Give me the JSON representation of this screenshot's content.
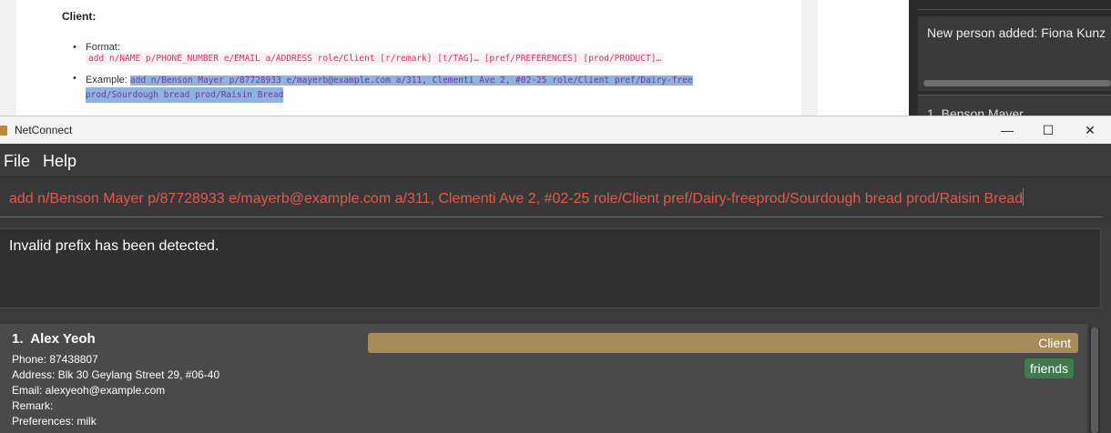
{
  "doc": {
    "heading": "Client:",
    "format_label": "Format:",
    "format_code": "add n/NAME p/PHONE_NUMBER e/EMAIL a/ADDRESS role/Client [r/remark] [t/TAG]… [pref/PREFERENCES] [prod/PRODUCT]…",
    "example_label": "Example:",
    "example_code_line1": "add n/Benson Mayer p/87728933 e/mayerb@example.com a/311, Clementi Ave 2, #02-25 role/Client pref/Dairy-free",
    "example_code_line2": "prod/Sourdough bread prod/Raisin Bread"
  },
  "other_app": {
    "message": "New person added: Fiona Kunz",
    "list_item": "1.  Benson Mayer"
  },
  "window": {
    "title": "NetConnect",
    "minimize_icon": "—",
    "maximize_icon": "☐",
    "close_icon": "✕"
  },
  "menu": {
    "file": "File",
    "help": "Help"
  },
  "command": {
    "value": "add n/Benson Mayer p/87728933 e/mayerb@example.com a/311, Clementi Ave 2, #02-25 role/Client pref/Dairy-freeprod/Sourdough bread prod/Raisin Bread"
  },
  "result": {
    "message": "Invalid prefix has been detected."
  },
  "persons": [
    {
      "index": "1.",
      "name": "Alex Yeoh",
      "phone": "Phone: 87438807",
      "address": "Address: Blk 30 Geylang Street 29, #06-40",
      "email": "Email: alexyeoh@example.com",
      "remark": "Remark:",
      "preferences": "Preferences: milk",
      "role_tag": "Client",
      "tag": "friends"
    }
  ],
  "colors": {
    "role_tag": "#a68b5b",
    "friends_tag": "#3e7b4f",
    "command_text": "#e05a4b"
  }
}
